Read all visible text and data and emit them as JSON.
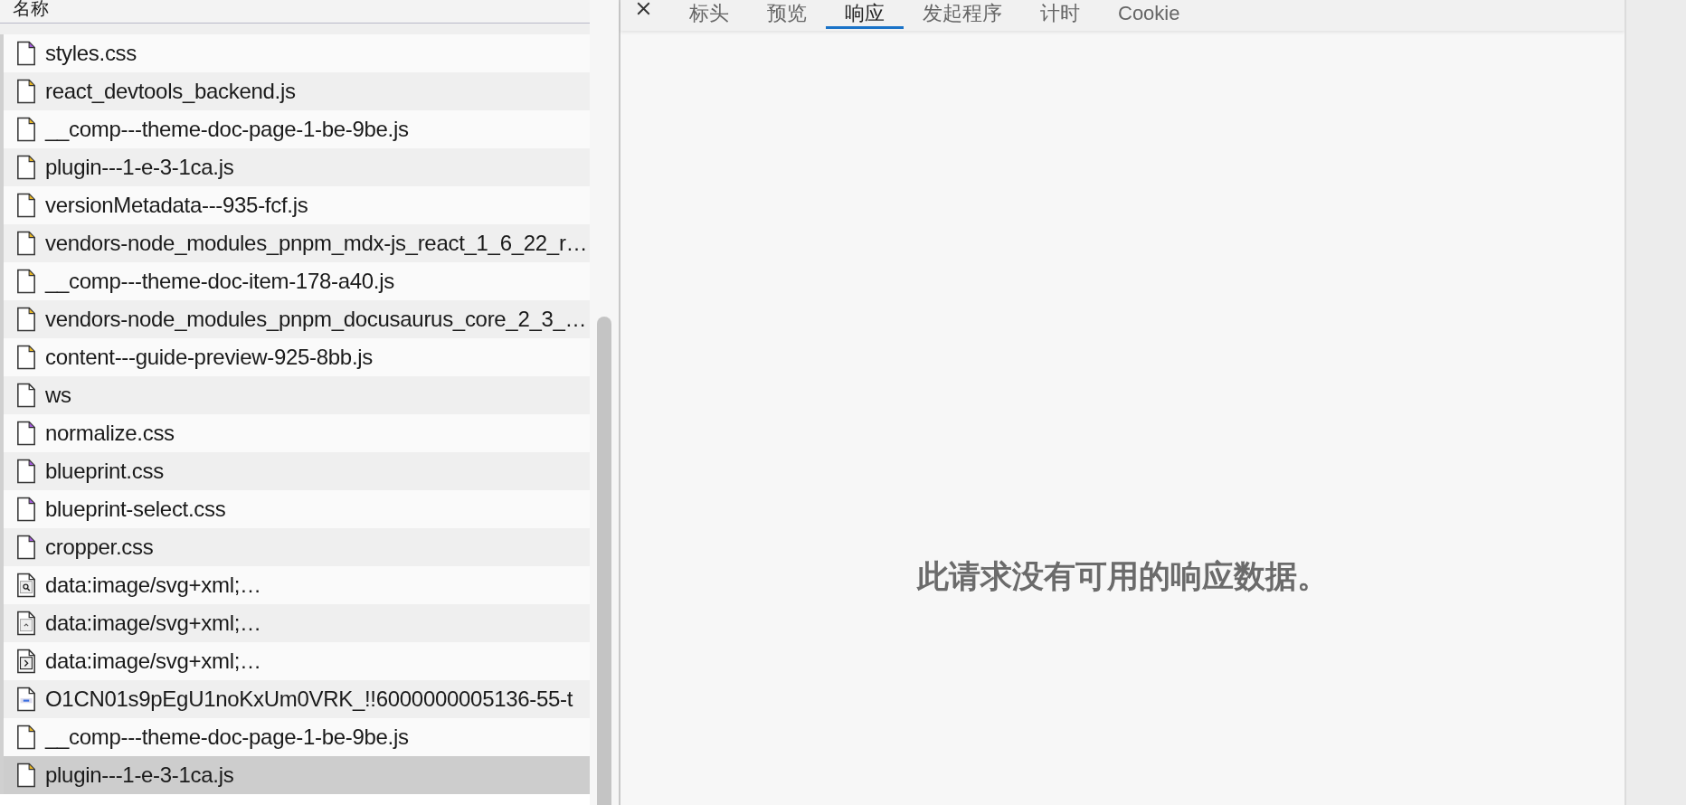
{
  "requests": {
    "header": "名称",
    "rows": [
      {
        "name": "styles.css",
        "kind": "stylesheet",
        "selected": false
      },
      {
        "name": "react_devtools_backend.js",
        "kind": "script",
        "selected": false
      },
      {
        "name": "__comp---theme-doc-page-1-be-9be.js",
        "kind": "script",
        "selected": false
      },
      {
        "name": "plugin---1-e-3-1ca.js",
        "kind": "script",
        "selected": false
      },
      {
        "name": "versionMetadata---935-fcf.js",
        "kind": "script",
        "selected": false
      },
      {
        "name": "vendors-node_modules_pnpm_mdx-js_react_1_6_22_r…",
        "kind": "script",
        "selected": false
      },
      {
        "name": "__comp---theme-doc-item-178-a40.js",
        "kind": "script",
        "selected": false
      },
      {
        "name": "vendors-node_modules_pnpm_docusaurus_core_2_3_…",
        "kind": "script",
        "selected": false
      },
      {
        "name": "content---guide-preview-925-8bb.js",
        "kind": "script",
        "selected": false
      },
      {
        "name": "ws",
        "kind": "plain",
        "selected": false
      },
      {
        "name": "normalize.css",
        "kind": "stylesheet",
        "selected": false
      },
      {
        "name": "blueprint.css",
        "kind": "stylesheet",
        "selected": false
      },
      {
        "name": "blueprint-select.css",
        "kind": "stylesheet",
        "selected": false
      },
      {
        "name": "cropper.css",
        "kind": "stylesheet",
        "selected": false
      },
      {
        "name": "data:image/svg+xml;…",
        "kind": "image-search",
        "selected": false
      },
      {
        "name": "data:image/svg+xml;…",
        "kind": "image-caret",
        "selected": false
      },
      {
        "name": "data:image/svg+xml;…",
        "kind": "image-chevron",
        "selected": false
      },
      {
        "name": "O1CN01s9pEgU1noKxUm0VRK_!!6000000005136-55-t",
        "kind": "image",
        "selected": false
      },
      {
        "name": "__comp---theme-doc-page-1-be-9be.js",
        "kind": "script",
        "selected": false
      },
      {
        "name": "plugin---1-e-3-1ca.js",
        "kind": "script",
        "selected": true
      }
    ]
  },
  "detail": {
    "tabs": [
      {
        "label": "标头",
        "selected": false
      },
      {
        "label": "预览",
        "selected": false
      },
      {
        "label": "响应",
        "selected": true
      },
      {
        "label": "发起程序",
        "selected": false
      },
      {
        "label": "计时",
        "selected": false
      },
      {
        "label": "Cookie",
        "selected": false
      }
    ],
    "empty_message": "此请求没有可用的响应数据。"
  }
}
